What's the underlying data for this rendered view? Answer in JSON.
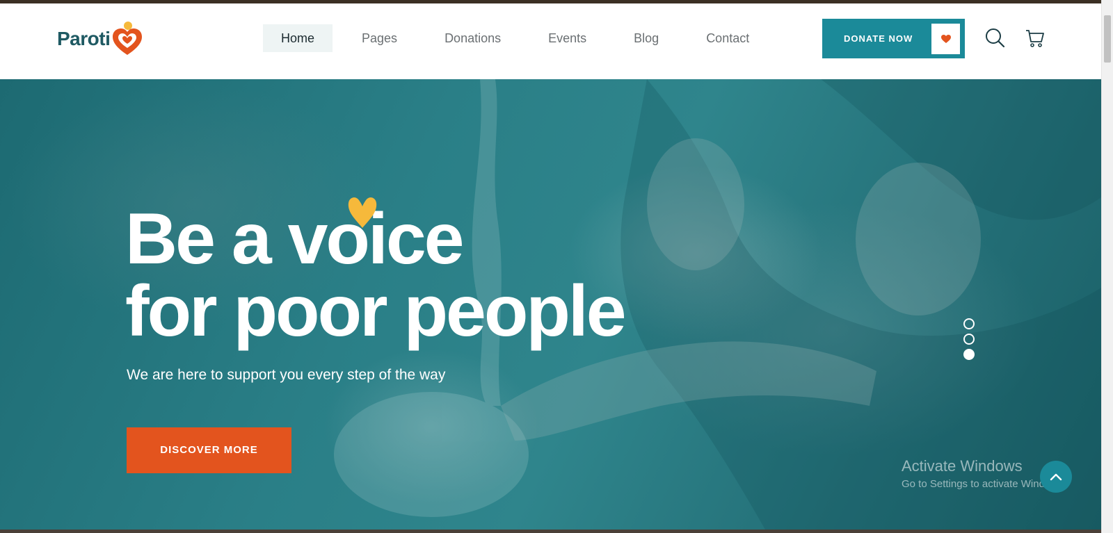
{
  "brand": {
    "name": "Paroti",
    "primary_color": "#1b8a99",
    "accent_color": "#e3541e",
    "heart_color": "#f6b93b",
    "logo_icon": "heart-logo-icon"
  },
  "nav": {
    "items": [
      {
        "label": "Home",
        "active": true
      },
      {
        "label": "Pages",
        "active": false
      },
      {
        "label": "Donations",
        "active": false
      },
      {
        "label": "Events",
        "active": false
      },
      {
        "label": "Blog",
        "active": false
      },
      {
        "label": "Contact",
        "active": false
      }
    ]
  },
  "header": {
    "donate_label": "DONATE NOW",
    "donate_icon": "heart-icon",
    "search_icon": "search-icon",
    "cart_icon": "cart-icon"
  },
  "hero": {
    "title_line1": "Be a voice",
    "title_line2": "for poor people",
    "subtitle": "We are here to support you every step of the way",
    "cta_label": "DISCOVER MORE",
    "slides": 3,
    "active_slide": 3
  },
  "overlay": {
    "activate_title": "Activate Windows",
    "activate_sub": "Go to Settings to activate Windows."
  },
  "scroll_top_icon": "chevron-up-icon"
}
